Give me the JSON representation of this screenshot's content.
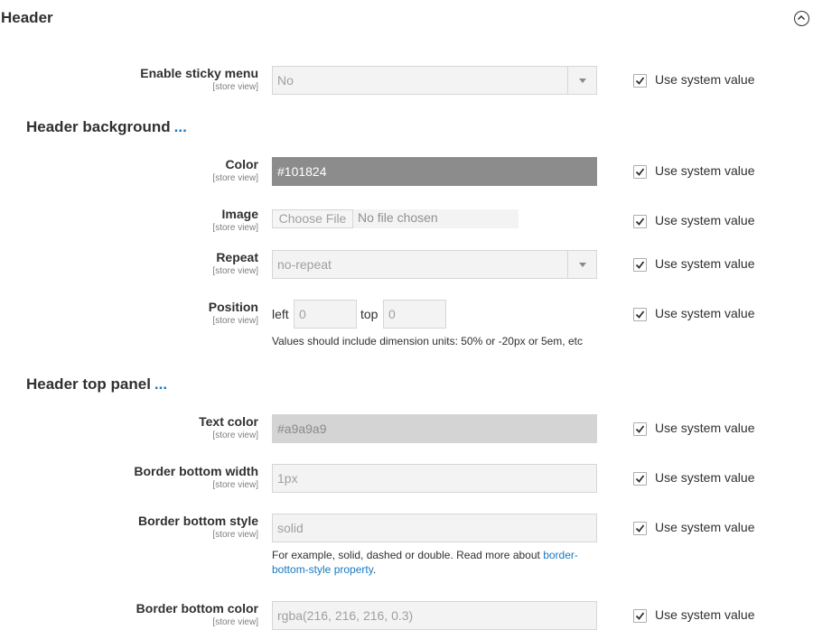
{
  "section": {
    "title": "Header"
  },
  "common": {
    "scope": "[store view]",
    "use_system": "Use system value"
  },
  "sticky": {
    "label": "Enable sticky menu",
    "value": "No"
  },
  "bg": {
    "title": "Header background",
    "dots": "...",
    "color_label": "Color",
    "color_value": "#101824",
    "image_label": "Image",
    "choose_file": "Choose File",
    "no_file": "No file chosen",
    "repeat_label": "Repeat",
    "repeat_value": "no-repeat",
    "position_label": "Position",
    "left_word": "left",
    "left_value": "0",
    "top_word": "top",
    "top_value": "0",
    "position_note": "Values should include dimension units: 50% or -20px or 5em, etc"
  },
  "top_panel": {
    "title": "Header top panel",
    "dots": "...",
    "text_color_label": "Text color",
    "text_color_value": "#a9a9a9",
    "bbw_label": "Border bottom width",
    "bbw_value": "1px",
    "bbs_label": "Border bottom style",
    "bbs_value": "solid",
    "bbs_note": "For example, solid, dashed or double. Read more about ",
    "bbs_link": "border-bottom-style property",
    "bbs_note_end": ".",
    "bbc_label": "Border bottom color",
    "bbc_value": "rgba(216, 216, 216, 0.3)"
  },
  "colors": {
    "link": "#1979c3",
    "color_swatch_bg": "#8c8c8c",
    "text_color_bg": "#d4d4d4"
  }
}
